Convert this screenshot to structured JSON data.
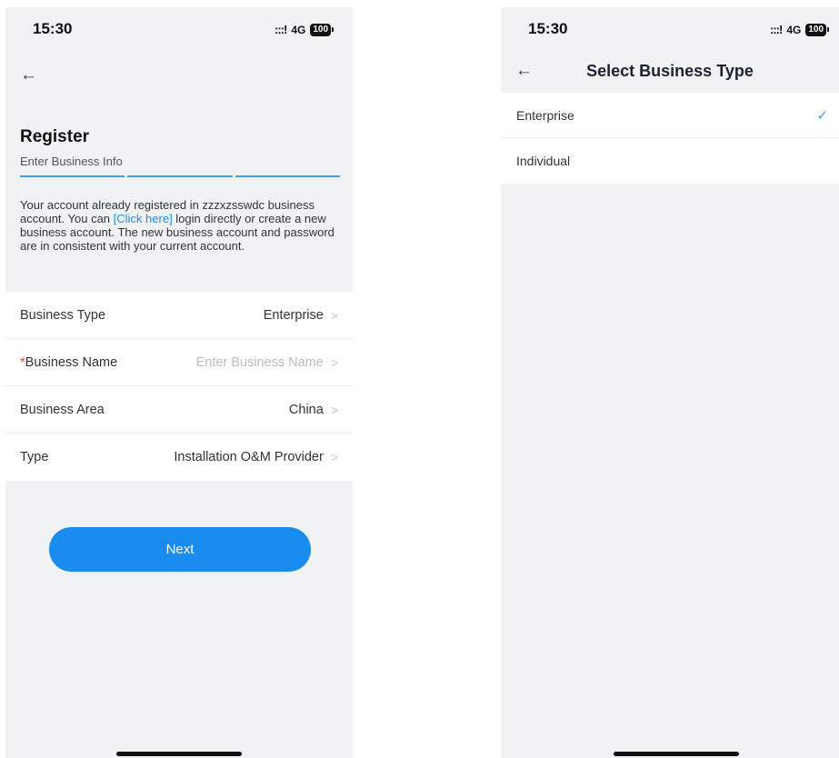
{
  "left_screen": {
    "status_bar": {
      "time": "15:30",
      "signal": ":::!",
      "network": "4G",
      "battery": "100"
    },
    "back_icon": "←",
    "title": "Register",
    "subtitle": "Enter Business Info",
    "progress_steps": 3,
    "notice": {
      "before": "Your account already registered in zzzxzsswdc business account. You can ",
      "link": "[Click here]",
      "after": " login directly or create a new business account. The new business account and password are in consistent with your current account."
    },
    "form": [
      {
        "label": "Business Type",
        "value": "Enterprise",
        "required": false,
        "placeholder": false
      },
      {
        "label": "Business Name",
        "value": "Enter Business Name",
        "required": true,
        "placeholder": true
      },
      {
        "label": "Business Area",
        "value": "China",
        "required": false,
        "placeholder": false
      },
      {
        "label": "Type",
        "value": "Installation O&M Provider",
        "required": false,
        "placeholder": false
      }
    ],
    "required_mark": "*",
    "chevron": ">",
    "next_label": "Next"
  },
  "right_screen": {
    "status_bar": {
      "time": "15:30",
      "signal": ":::!",
      "network": "4G",
      "battery": "100"
    },
    "back_icon": "←",
    "title": "Select Business Type",
    "options": [
      {
        "label": "Enterprise",
        "selected": true
      },
      {
        "label": "Individual",
        "selected": false
      }
    ],
    "check_icon": "✓"
  },
  "colors": {
    "accent": "#1a8cf0",
    "background": "#f1f2f4",
    "required": "#e24c4c"
  }
}
